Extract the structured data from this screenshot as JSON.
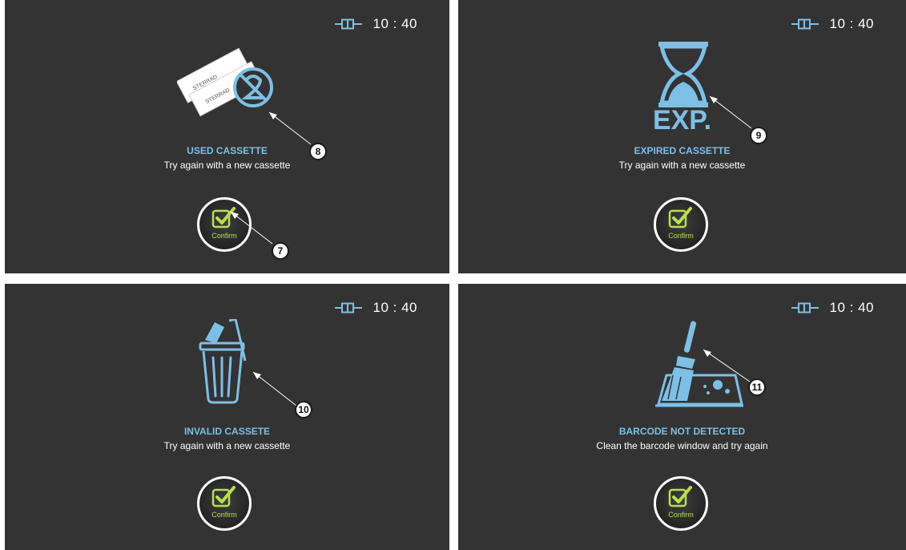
{
  "colors": {
    "panel_bg": "#333333",
    "accent_blue": "#7cc0e6",
    "confirm_green": "#b9e04a",
    "text": "#ffffff"
  },
  "panels": [
    {
      "status": {
        "icon": "battery-icon",
        "time": "10 : 40"
      },
      "title": "USED CASSETTE",
      "message": "Try again with a new cassette",
      "icon": "used-cassette-icon",
      "cassette_label": "STERRAD",
      "confirm_label": "Confirm",
      "callouts": [
        "8",
        "7"
      ]
    },
    {
      "status": {
        "icon": "battery-icon",
        "time": "10 : 40"
      },
      "title": "EXPIRED CASSETTE",
      "message": "Try again with a new cassette",
      "icon": "hourglass-icon",
      "icon_text": "EXP.",
      "confirm_label": "Confirm",
      "callouts": [
        "9"
      ]
    },
    {
      "status": {
        "icon": "battery-icon",
        "time": "10 : 40"
      },
      "title": "INVALID CASSETE",
      "message": "Try again with a new cassette",
      "icon": "trash-can-icon",
      "confirm_label": "Confirm",
      "callouts": [
        "10"
      ]
    },
    {
      "status": {
        "icon": "battery-icon",
        "time": "10 : 40"
      },
      "title": "BARCODE NOT DETECTED",
      "message": "Clean the barcode window and try again",
      "icon": "brush-cleaning-icon",
      "confirm_label": "Confirm",
      "callouts": [
        "11"
      ]
    }
  ]
}
